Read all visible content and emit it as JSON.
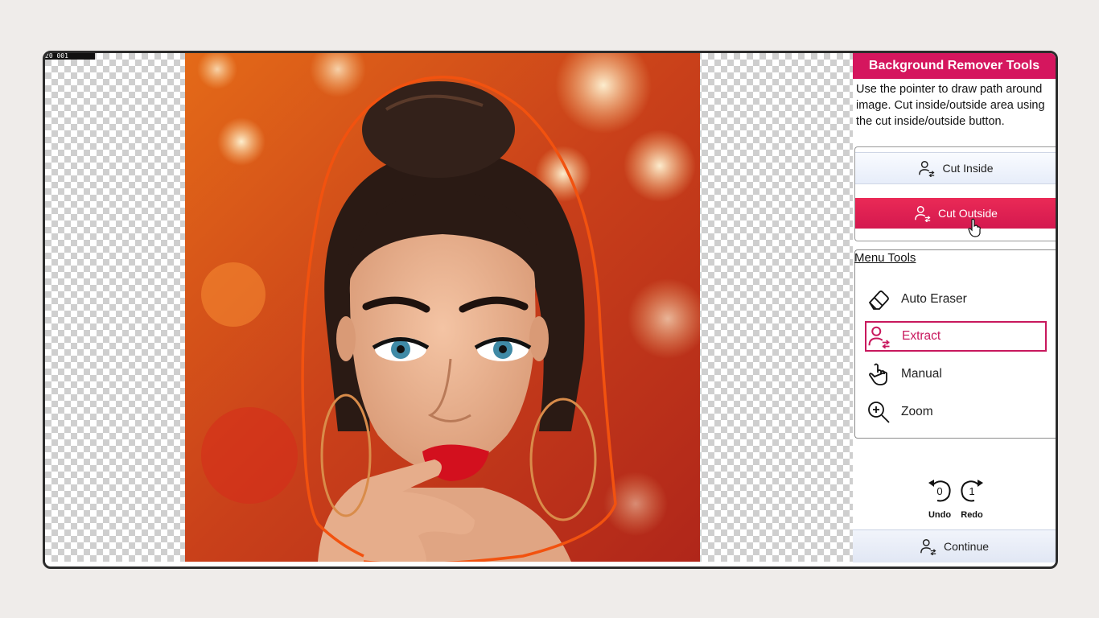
{
  "panel": {
    "title": "Background Remover Tools",
    "instructions": [
      "Use the pointer to draw path around",
      "image. Cut inside/outside area using",
      "the cut inside/outside button."
    ],
    "cut_inside_label": "Cut Inside",
    "cut_outside_label": "Cut Outside",
    "menu_title": "Menu Tools",
    "menu_items": [
      {
        "label": "Auto Eraser",
        "icon": "eraser-icon",
        "active": false
      },
      {
        "label": "Extract",
        "icon": "person-swap-icon",
        "active": true
      },
      {
        "label": "Manual",
        "icon": "hand-pointer-icon",
        "active": false
      },
      {
        "label": "Zoom",
        "icon": "zoom-in-icon",
        "active": false
      }
    ],
    "undo": {
      "count": "0",
      "label": "Undo"
    },
    "redo": {
      "count": "1",
      "label": "Redo"
    },
    "continue_label": "Continue"
  },
  "canvas": {
    "corner_label": "20 001",
    "path_color": "#f2520f"
  },
  "colors": {
    "accent": "#d5165e",
    "active_border": "#c8185d"
  }
}
